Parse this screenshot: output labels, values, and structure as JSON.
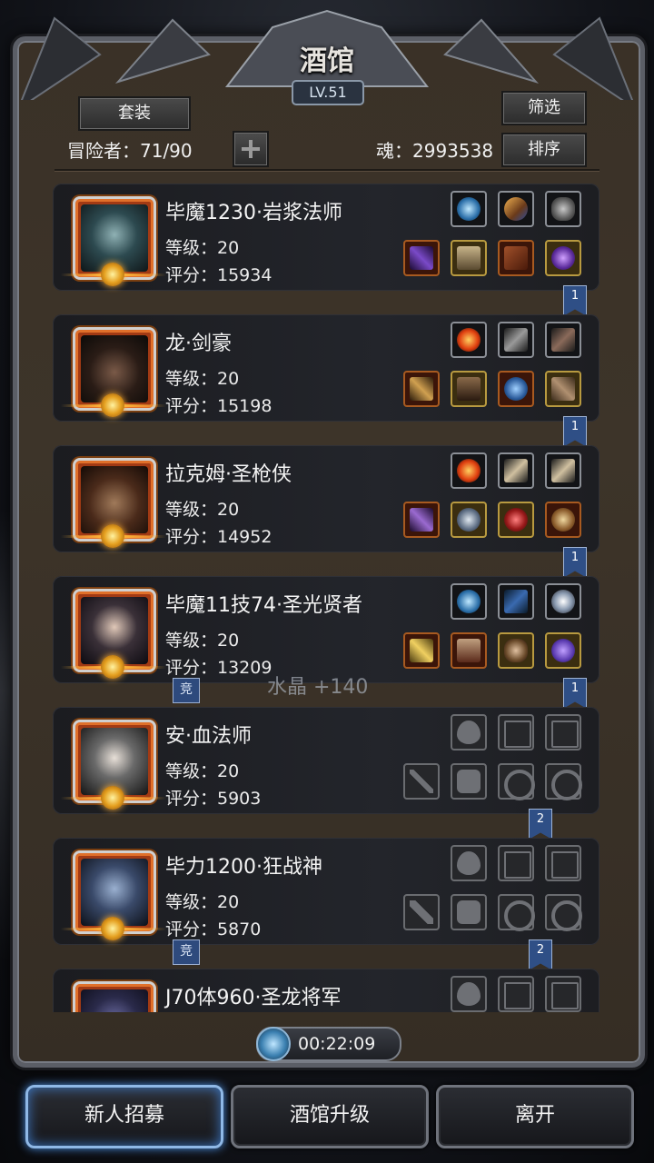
{
  "header": {
    "title": "酒馆",
    "level": "LV.51",
    "set_button": "套装",
    "filter_button": "筛选",
    "sort_button": "排序",
    "adventurers": "冒险者：71/90",
    "soul": "魂：2993538"
  },
  "heroes": [
    {
      "name": "毕魔1230·岩浆法师",
      "level": "等级：20",
      "score": "评分：15934",
      "ribbon": "1",
      "badge": ""
    },
    {
      "name": "龙·剑豪",
      "level": "等级：20",
      "score": "评分：15198",
      "ribbon": "1",
      "badge": ""
    },
    {
      "name": "拉克姆·圣枪侠",
      "level": "等级：20",
      "score": "评分：14952",
      "ribbon": "1",
      "badge": ""
    },
    {
      "name": "毕魔11技74·圣光贤者",
      "level": "等级：20",
      "score": "评分：13209",
      "ribbon": "1",
      "badge": "竞"
    },
    {
      "name": "安·血法师",
      "level": "等级：20",
      "score": "评分：5903",
      "ribbon": "2",
      "badge": ""
    },
    {
      "name": "毕力1200·狂战神",
      "level": "等级：20",
      "score": "评分：5870",
      "ribbon": "2",
      "badge": "竞"
    },
    {
      "name": "J70体960·圣龙将军",
      "level": "",
      "score": "",
      "ribbon": "",
      "badge": ""
    }
  ],
  "floating_text": "水晶 +140",
  "timer": "00:22:09",
  "bottom": {
    "recruit": "新人招募",
    "upgrade": "酒馆升级",
    "leave": "离开"
  },
  "colors": {
    "accent": "#4b8ee0",
    "frame": "#3d3429",
    "ribbon": "#2f4f86"
  }
}
